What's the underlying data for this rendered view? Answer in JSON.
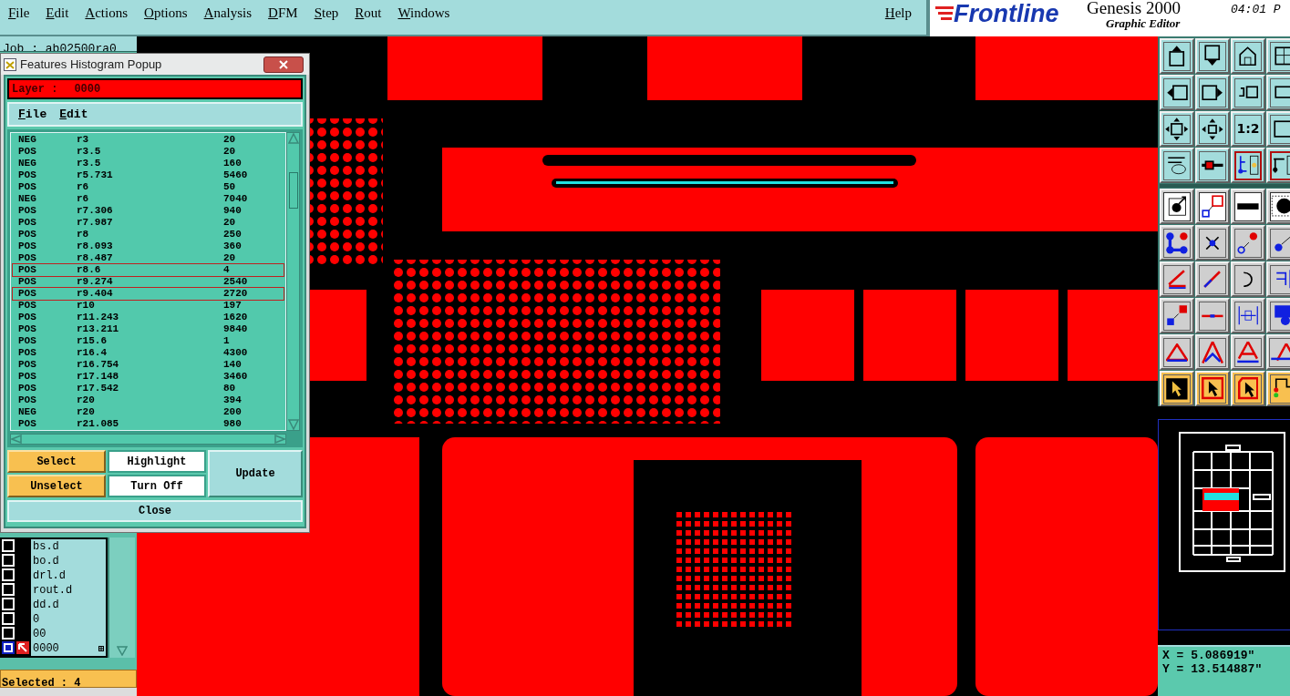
{
  "menu_bar": {
    "items": [
      "File",
      "Edit",
      "Actions",
      "Options",
      "Analysis",
      "DFM",
      "Step",
      "Rout",
      "Windows"
    ],
    "help": "Help"
  },
  "brand": {
    "product": "Genesis 2000",
    "logo": "Frontline",
    "subtitle": "Graphic Editor",
    "clock": "04:01 P"
  },
  "job_label": "Job : ab02500ra0",
  "histogram_popup": {
    "title": "Features Histogram Popup",
    "layer_label": "Layer :",
    "layer": "0000",
    "menu": [
      "File",
      "Edit"
    ],
    "rows": [
      {
        "polarity": "NEG",
        "symbol": "r3",
        "count": "20",
        "selected": false
      },
      {
        "polarity": "POS",
        "symbol": "r3.5",
        "count": "20",
        "selected": false
      },
      {
        "polarity": "NEG",
        "symbol": "r3.5",
        "count": "160",
        "selected": false
      },
      {
        "polarity": "POS",
        "symbol": "r5.731",
        "count": "5460",
        "selected": false
      },
      {
        "polarity": "POS",
        "symbol": "r6",
        "count": "50",
        "selected": false
      },
      {
        "polarity": "NEG",
        "symbol": "r6",
        "count": "7040",
        "selected": false
      },
      {
        "polarity": "POS",
        "symbol": "r7.306",
        "count": "940",
        "selected": false
      },
      {
        "polarity": "POS",
        "symbol": "r7.987",
        "count": "20",
        "selected": false
      },
      {
        "polarity": "POS",
        "symbol": "r8",
        "count": "250",
        "selected": false
      },
      {
        "polarity": "POS",
        "symbol": "r8.093",
        "count": "360",
        "selected": false
      },
      {
        "polarity": "POS",
        "symbol": "r8.487",
        "count": "20",
        "selected": false
      },
      {
        "polarity": "POS",
        "symbol": "r8.6",
        "count": "4",
        "selected": true
      },
      {
        "polarity": "POS",
        "symbol": "r9.274",
        "count": "2540",
        "selected": false
      },
      {
        "polarity": "POS",
        "symbol": "r9.404",
        "count": "2720",
        "selected": true
      },
      {
        "polarity": "POS",
        "symbol": "r10",
        "count": "197",
        "selected": false
      },
      {
        "polarity": "POS",
        "symbol": "r11.243",
        "count": "1620",
        "selected": false
      },
      {
        "polarity": "POS",
        "symbol": "r13.211",
        "count": "9840",
        "selected": false
      },
      {
        "polarity": "POS",
        "symbol": "r15.6",
        "count": "1",
        "selected": false
      },
      {
        "polarity": "POS",
        "symbol": "r16.4",
        "count": "4300",
        "selected": false
      },
      {
        "polarity": "POS",
        "symbol": "r16.754",
        "count": "140",
        "selected": false
      },
      {
        "polarity": "POS",
        "symbol": "r17.148",
        "count": "3460",
        "selected": false
      },
      {
        "polarity": "POS",
        "symbol": "r17.542",
        "count": "80",
        "selected": false
      },
      {
        "polarity": "POS",
        "symbol": "r20",
        "count": "394",
        "selected": false
      },
      {
        "polarity": "NEG",
        "symbol": "r20",
        "count": "200",
        "selected": false
      },
      {
        "polarity": "POS",
        "symbol": "r21.085",
        "count": "980",
        "selected": false
      }
    ],
    "buttons": [
      {
        "label": "Select",
        "kind": "select"
      },
      {
        "label": "Highlight",
        "kind": "display"
      },
      {
        "label": "Update",
        "kind": "action"
      },
      {
        "label": "Unselect",
        "kind": "select"
      },
      {
        "label": "Turn Off",
        "kind": "display"
      }
    ],
    "close": "Close"
  },
  "layers": [
    {
      "name": "bs.d",
      "active": false
    },
    {
      "name": "bo.d",
      "active": false
    },
    {
      "name": "drl.d",
      "active": false
    },
    {
      "name": "rout.d",
      "active": false
    },
    {
      "name": "dd.d",
      "active": false
    },
    {
      "name": "0",
      "active": false
    },
    {
      "name": "00",
      "active": false
    },
    {
      "name": "0000",
      "active": true
    }
  ],
  "status": "Selected : 4",
  "zoom_ratio_label": "1:2",
  "coordinates": {
    "x": "X = 5.086919\"",
    "y": "Y = 13.514887\""
  }
}
